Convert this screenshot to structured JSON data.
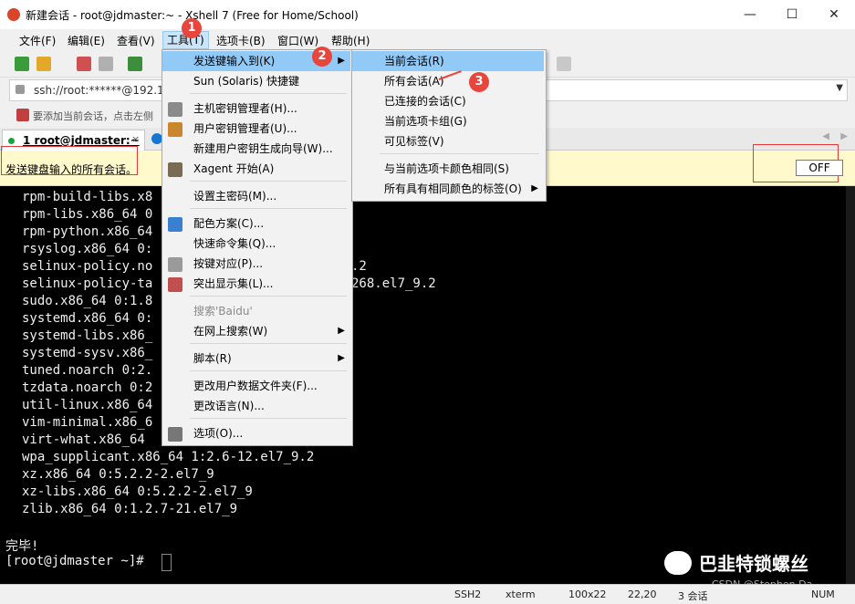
{
  "window": {
    "title": "新建会话 - root@jdmaster:~ - Xshell 7 (Free for Home/School)",
    "minimize": "—",
    "maximize": "☐",
    "close": "✕"
  },
  "menubar": {
    "items": [
      "文件(F)",
      "编辑(E)",
      "查看(V)",
      "工具(T)",
      "选项卡(B)",
      "窗口(W)",
      "帮助(H)"
    ]
  },
  "address": {
    "text": "ssh://root:******@192.16"
  },
  "hint": {
    "text": "要添加当前会话，点击左侧"
  },
  "tabs": {
    "active_label": "1 root@jdmaster:~",
    "close": "×"
  },
  "compose": {
    "text": "发送键盘输入的所有会话。",
    "toggle": "OFF"
  },
  "terminal": {
    "lines": [
      "rpm-build-libs.x8",
      "rpm-libs.x86_64 0",
      "rpm-python.x86_64",
      "rsyslog.x86_64 0:",
      "selinux-policy.no",
      "selinux-policy-ta",
      "sudo.x86_64 0:1.8",
      "systemd.x86_64 0:",
      "systemd-libs.x86_",
      "systemd-sysv.x86_",
      "tuned.noarch 0:2.",
      "tzdata.noarch 0:2",
      "util-linux.x86_64",
      "vim-minimal.x86_6",
      "virt-what.x86_64",
      "wpa_supplicant.x86_64 1:2.6-12.el7_9.2",
      "xz.x86_64 0:5.2.2-2.el7_9",
      "xz-libs.x86_64 0:5.2.2-2.el7_9",
      "zlib.x86_64 0:1.2.7-21.el7_9"
    ],
    "overflow_right": [
      ".2",
      "268.el7_9.2"
    ],
    "done": "完毕!",
    "prompt": "[root@jdmaster ~]#"
  },
  "watermark": {
    "text": "巴韭特锁螺丝",
    "csdn": "CSDN @Stephen Da"
  },
  "statusbar": {
    "ssh": "SSH2",
    "term": "xterm",
    "size": "100x22",
    "pos": "22,20",
    "sessions": "3 会话",
    "num": "NUM"
  },
  "tools_menu": {
    "items": [
      {
        "label": "发送键输入到(K)",
        "submenu": true,
        "highlight": true
      },
      {
        "label": "Sun (Solaris) 快捷键"
      },
      {
        "label": "主机密钥管理者(H)..."
      },
      {
        "label": "用户密钥管理者(U)..."
      },
      {
        "label": "新建用户密钥生成向导(W)..."
      },
      {
        "label": "Xagent 开始(A)"
      },
      {
        "label": "设置主密码(M)..."
      },
      {
        "label": "配色方案(C)..."
      },
      {
        "label": "快速命令集(Q)..."
      },
      {
        "label": "按键对应(P)..."
      },
      {
        "label": "突出显示集(L)..."
      },
      {
        "label": "搜索'Baidu'",
        "disabled": true
      },
      {
        "label": "在网上搜索(W)",
        "submenu": true
      },
      {
        "label": "脚本(R)",
        "submenu": true
      },
      {
        "label": "更改用户数据文件夹(F)..."
      },
      {
        "label": "更改语言(N)..."
      },
      {
        "label": "选项(O)..."
      }
    ]
  },
  "send_submenu": {
    "items": [
      {
        "label": "当前会话(R)",
        "highlight": true
      },
      {
        "label": "所有会话(A)"
      },
      {
        "label": "已连接的会话(C)"
      },
      {
        "label": "当前选项卡组(G)"
      },
      {
        "label": "可见标签(V)"
      },
      {
        "label": "与当前选项卡颜色相同(S)"
      },
      {
        "label": "所有具有相同颜色的标签(O)",
        "submenu": true
      }
    ]
  },
  "markers": [
    "1",
    "2",
    "3"
  ],
  "arrow_glyph": "▶"
}
